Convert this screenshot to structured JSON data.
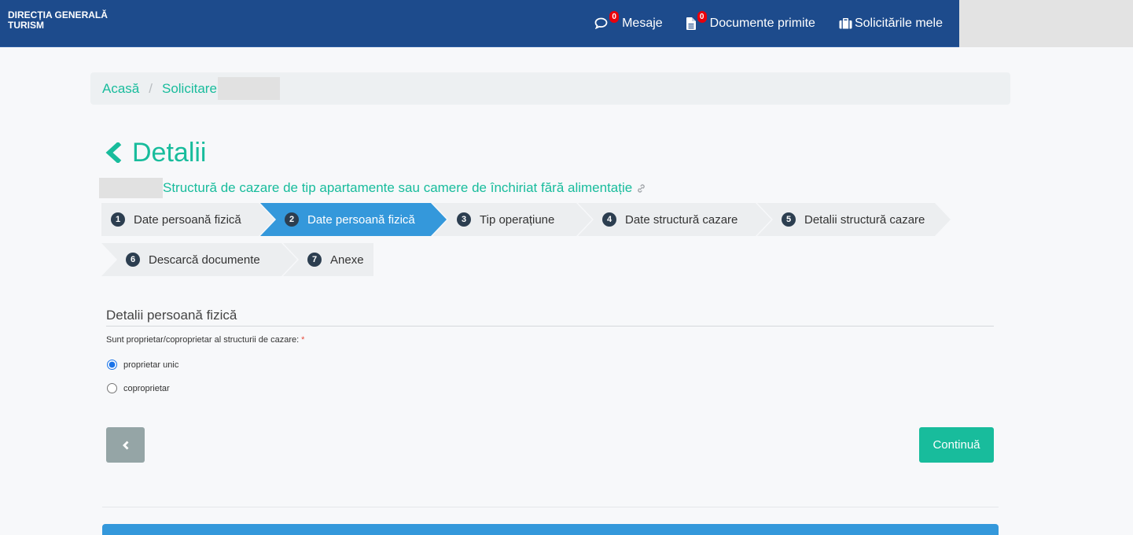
{
  "navbar": {
    "brand": {
      "line1": "DIRECȚIA GENERALĂ",
      "line2": "TURISM"
    },
    "items": [
      {
        "label": "Mesaje",
        "badge": "0",
        "icon": "comment-icon"
      },
      {
        "label": "Documente primite",
        "badge": "0",
        "icon": "document-icon"
      },
      {
        "label": "Solicitările mele",
        "icon": "briefcase-icon"
      }
    ]
  },
  "breadcrumb": {
    "home": "Acasă",
    "separator": "/",
    "current": "Solicitare"
  },
  "page": {
    "title": "Detalii",
    "title_icon": "chevron-left-icon",
    "subtitle": "Structură de cazare de tip apartamente sau camere de închiriat fără alimentație",
    "subtitle_icon": "link-icon"
  },
  "steps": [
    {
      "number": "1",
      "label": "Date persoană fizică",
      "active": false
    },
    {
      "number": "2",
      "label": "Date persoană fizică",
      "active": true
    },
    {
      "number": "3",
      "label": "Tip operațiune",
      "active": false
    },
    {
      "number": "4",
      "label": "Date structură cazare",
      "active": false
    },
    {
      "number": "5",
      "label": "Detalii structură cazare",
      "active": false
    },
    {
      "number": "6",
      "label": "Descarcă documente",
      "active": false
    },
    {
      "number": "7",
      "label": "Anexe",
      "active": false
    }
  ],
  "form": {
    "section_title": "Detalii persoană fizică",
    "question": "Sunt proprietar/coproprietar al structurii de cazare:",
    "required_mark": "*",
    "options": [
      {
        "label": "proprietar unic",
        "checked": true
      },
      {
        "label": "coproprietar",
        "checked": false
      }
    ]
  },
  "buttons": {
    "back_icon": "chevron-left-icon",
    "continue": "Continuă"
  },
  "colors": {
    "nav": "#1d4b8c",
    "accent": "#18bc9c",
    "active_step": "#3498db",
    "badge": "#e8000b",
    "step_background": "#eceef0",
    "step_number": "#2c3e50",
    "back_button": "#95a5a6"
  }
}
